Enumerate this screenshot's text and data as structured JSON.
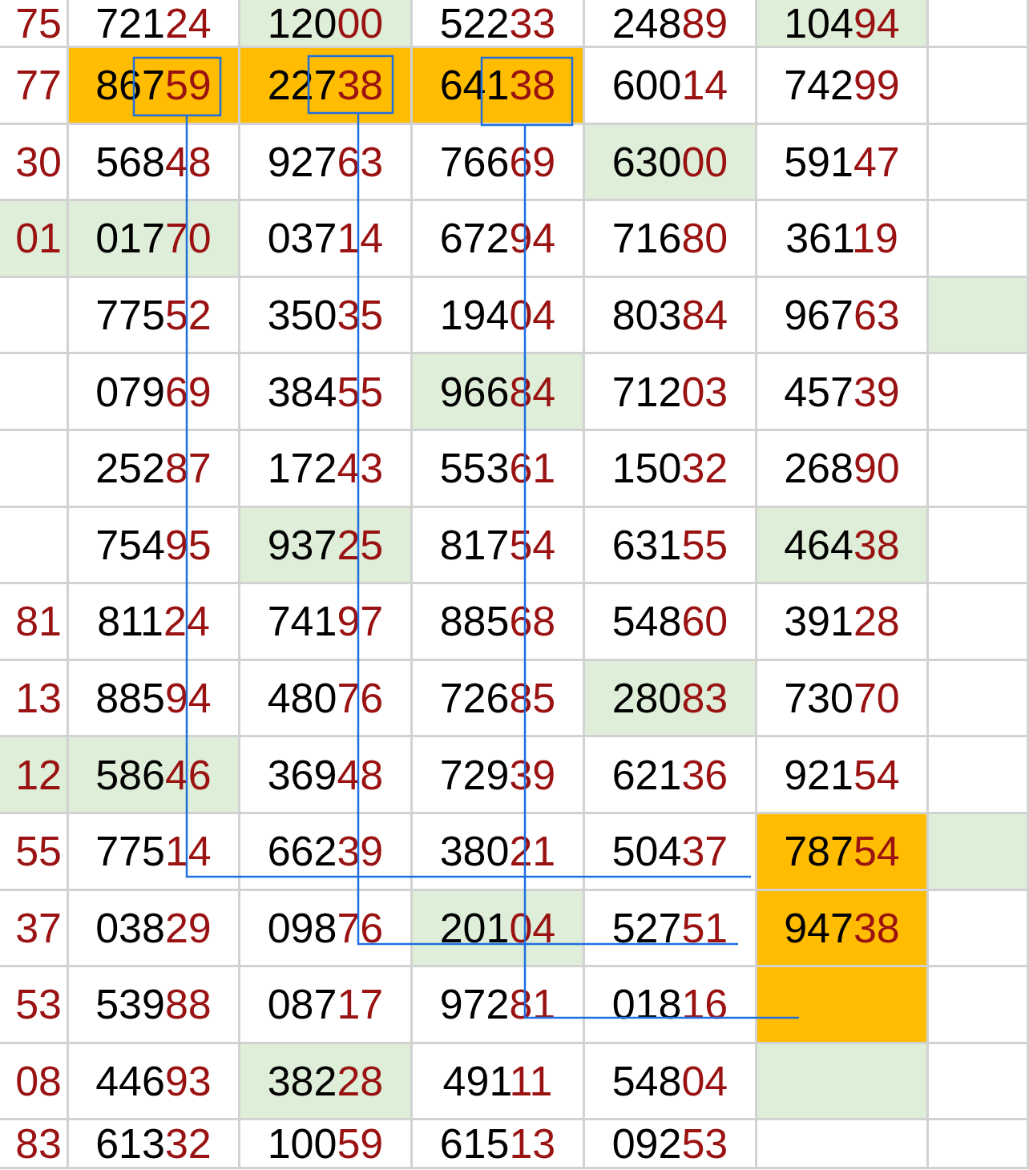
{
  "rows": [
    [
      {
        "tail": "75"
      },
      {
        "head": "721",
        "tail": "24"
      },
      {
        "head": "120",
        "tail": "00",
        "color": "#dfeed8"
      },
      {
        "head": "522",
        "tail": "33"
      },
      {
        "head": "248",
        "tail": "89"
      },
      {
        "head": "104",
        "tail": "94",
        "color": "#dfeed8"
      },
      {}
    ],
    [
      {
        "tail": "77"
      },
      {
        "head": "867",
        "tail": "59",
        "color": "#ffbc00"
      },
      {
        "head": "227",
        "tail": "38",
        "color": "#ffbc00"
      },
      {
        "head": "641",
        "tail": "38",
        "color": "#ffbc00"
      },
      {
        "head": "600",
        "tail": "14"
      },
      {
        "head": "742",
        "tail": "99"
      },
      {}
    ],
    [
      {
        "tail": "30"
      },
      {
        "head": "568",
        "tail": "48"
      },
      {
        "head": "927",
        "tail": "63"
      },
      {
        "head": "766",
        "tail": "69"
      },
      {
        "head": "630",
        "tail": "00",
        "color": "#dfeed8"
      },
      {
        "head": "591",
        "tail": "47"
      },
      {}
    ],
    [
      {
        "tail": "01",
        "color": "#dfeed8"
      },
      {
        "head": "017",
        "tail": "70",
        "color": "#dfeed8"
      },
      {
        "head": "037",
        "tail": "14"
      },
      {
        "head": "672",
        "tail": "94"
      },
      {
        "head": "716",
        "tail": "80"
      },
      {
        "head": "361",
        "tail": "19"
      },
      {}
    ],
    [
      {},
      {
        "head": "775",
        "tail": "52"
      },
      {
        "head": "350",
        "tail": "35"
      },
      {
        "head": "194",
        "tail": "04"
      },
      {
        "head": "803",
        "tail": "84"
      },
      {
        "head": "967",
        "tail": "63"
      },
      {
        "color": "#dfeed8"
      }
    ],
    [
      {},
      {
        "head": "079",
        "tail": "69"
      },
      {
        "head": "384",
        "tail": "55"
      },
      {
        "head": "966",
        "tail": "84",
        "color": "#dfeed8"
      },
      {
        "head": "712",
        "tail": "03"
      },
      {
        "head": "457",
        "tail": "39"
      },
      {}
    ],
    [
      {},
      {
        "head": "252",
        "tail": "87"
      },
      {
        "head": "172",
        "tail": "43"
      },
      {
        "head": "553",
        "tail": "61"
      },
      {
        "head": "150",
        "tail": "32"
      },
      {
        "head": "268",
        "tail": "90"
      },
      {}
    ],
    [
      {},
      {
        "head": "754",
        "tail": "95"
      },
      {
        "head": "937",
        "tail": "25",
        "color": "#dfeed8"
      },
      {
        "head": "817",
        "tail": "54"
      },
      {
        "head": "631",
        "tail": "55"
      },
      {
        "head": "464",
        "tail": "38",
        "color": "#dfeed8"
      },
      {}
    ],
    [
      {
        "tail": "81"
      },
      {
        "head": "811",
        "tail": "24"
      },
      {
        "head": "741",
        "tail": "97"
      },
      {
        "head": "885",
        "tail": "68"
      },
      {
        "head": "548",
        "tail": "60"
      },
      {
        "head": "391",
        "tail": "28"
      },
      {}
    ],
    [
      {
        "tail": "13"
      },
      {
        "head": "885",
        "tail": "94"
      },
      {
        "head": "480",
        "tail": "76"
      },
      {
        "head": "726",
        "tail": "85"
      },
      {
        "head": "280",
        "tail": "83",
        "color": "#dfeed8"
      },
      {
        "head": "730",
        "tail": "70"
      },
      {}
    ],
    [
      {
        "tail": "12",
        "color": "#dfeed8"
      },
      {
        "head": "586",
        "tail": "46",
        "color": "#dfeed8"
      },
      {
        "head": "369",
        "tail": "48"
      },
      {
        "head": "729",
        "tail": "39"
      },
      {
        "head": "621",
        "tail": "36"
      },
      {
        "head": "921",
        "tail": "54"
      },
      {}
    ],
    [
      {
        "tail": "55"
      },
      {
        "head": "775",
        "tail": "14"
      },
      {
        "head": "662",
        "tail": "39"
      },
      {
        "head": "380",
        "tail": "21"
      },
      {
        "head": "504",
        "tail": "37"
      },
      {
        "head": "787",
        "tail": "54",
        "color": "#ffbc00"
      },
      {
        "color": "#dfeed8"
      }
    ],
    [
      {
        "tail": "37"
      },
      {
        "head": "038",
        "tail": "29"
      },
      {
        "head": "098",
        "tail": "76"
      },
      {
        "head": "201",
        "tail": "04",
        "color": "#dfeed8"
      },
      {
        "head": "527",
        "tail": "51"
      },
      {
        "head": "947",
        "tail": "38",
        "color": "#ffbc00"
      },
      {}
    ],
    [
      {
        "tail": "53"
      },
      {
        "head": "539",
        "tail": "88"
      },
      {
        "head": "087",
        "tail": "17"
      },
      {
        "head": "972",
        "tail": "81"
      },
      {
        "head": "018",
        "tail": "16"
      },
      {
        "color": "#ffbc00"
      },
      {}
    ],
    [
      {
        "tail": "08"
      },
      {
        "head": "446",
        "tail": "93"
      },
      {
        "head": "382",
        "tail": "28",
        "color": "#dfeed8"
      },
      {
        "head": "491",
        "tail": "11"
      },
      {
        "head": "548",
        "tail": "04"
      },
      {
        "color": "#dfeed8"
      },
      {}
    ],
    [
      {
        "tail": "83"
      },
      {
        "head": "613",
        "tail": "32"
      },
      {
        "head": "100",
        "tail": "59"
      },
      {
        "head": "615",
        "tail": "13"
      },
      {
        "head": "092",
        "tail": "53"
      },
      {},
      {}
    ]
  ]
}
